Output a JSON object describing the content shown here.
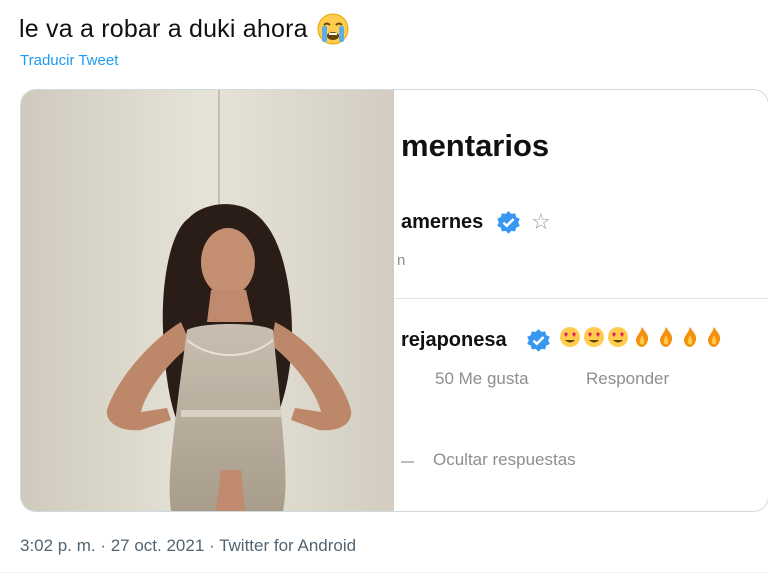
{
  "tweet": {
    "text": "le va a robar a duki ahora",
    "emoji": "crying-face",
    "translate_label": "Traducir Tweet",
    "timestamp": "3:02 p. m. · 27 oct. 2021 · Twitter for Android"
  },
  "screenshot": {
    "title": "mentarios",
    "comment1": {
      "username": "amernes",
      "sub": "n"
    },
    "comment2": {
      "username": "rejaponesa",
      "likes": "50 Me gusta",
      "reply": "Responder",
      "hide_replies": "Ocultar respuestas"
    }
  },
  "colors": {
    "link": "#1d9bf0",
    "verified": "#3897f0",
    "muted": "#8e8e8e",
    "timestamp": "#536471"
  }
}
